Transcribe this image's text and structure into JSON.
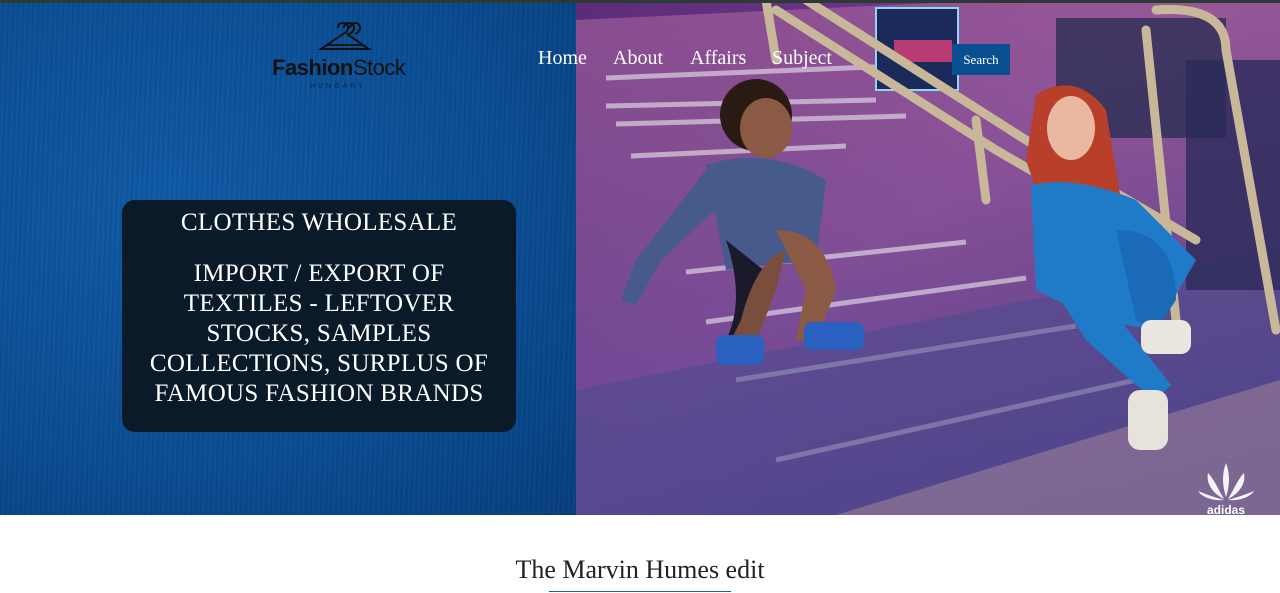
{
  "brand": {
    "name_bold": "Fashion",
    "name_light": "Stock",
    "subtitle": "HUNGARY"
  },
  "nav": {
    "items": [
      "Home",
      "About",
      "Affairs",
      "Subject"
    ],
    "search_label": "Search"
  },
  "hero": {
    "headline": "CLOTHES WHOLESALE",
    "description": "IMPORT / EXPORT OF TEXTILES - LEFTOVER STOCKS, SAMPLES COLLECTIONS, SURPLUS OF FAMOUS FASHION BRANDS",
    "photo_logo_text": "adidas"
  },
  "section": {
    "title": "The Marvin Humes edit"
  },
  "colors": {
    "hero_blue": "#0a4d94",
    "card_bg": "#0a1a28",
    "search_bg": "#0a4f8f",
    "rule": "#2a5d8f"
  }
}
